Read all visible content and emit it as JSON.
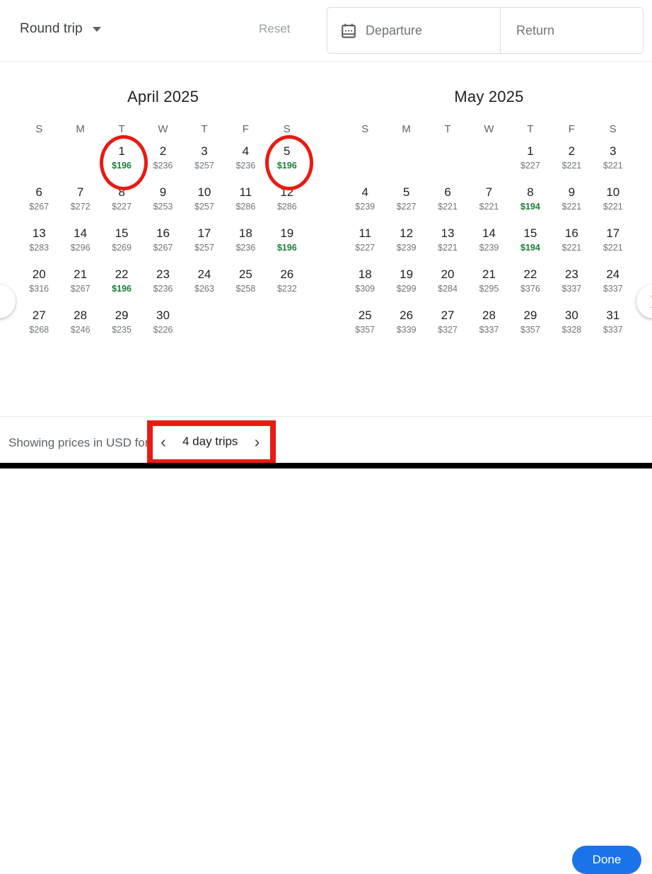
{
  "header": {
    "trip_type": "Round trip",
    "trip_type_icon": "chevron-down-icon",
    "reset_label": "Reset",
    "calendar_icon": "calendar-icon",
    "departure_placeholder": "Departure",
    "return_placeholder": "Return"
  },
  "nav": {
    "prev_icon": "chevron-left-icon",
    "next_icon": "chevron-right-icon"
  },
  "dow": [
    "S",
    "M",
    "T",
    "W",
    "T",
    "F",
    "S"
  ],
  "months": [
    {
      "title": "April 2025",
      "weeks": [
        [
          {
            "day": "",
            "price": ""
          },
          {
            "day": "",
            "price": ""
          },
          {
            "day": "1",
            "price": "$196",
            "cheap": true,
            "circled": true
          },
          {
            "day": "2",
            "price": "$236"
          },
          {
            "day": "3",
            "price": "$257"
          },
          {
            "day": "4",
            "price": "$236"
          },
          {
            "day": "5",
            "price": "$196",
            "cheap": true,
            "circled": true
          }
        ],
        [
          {
            "day": "6",
            "price": "$267"
          },
          {
            "day": "7",
            "price": "$272"
          },
          {
            "day": "8",
            "price": "$227"
          },
          {
            "day": "9",
            "price": "$253"
          },
          {
            "day": "10",
            "price": "$257"
          },
          {
            "day": "11",
            "price": "$286"
          },
          {
            "day": "12",
            "price": "$286"
          }
        ],
        [
          {
            "day": "13",
            "price": "$283"
          },
          {
            "day": "14",
            "price": "$296"
          },
          {
            "day": "15",
            "price": "$269"
          },
          {
            "day": "16",
            "price": "$267"
          },
          {
            "day": "17",
            "price": "$257"
          },
          {
            "day": "18",
            "price": "$236"
          },
          {
            "day": "19",
            "price": "$196",
            "cheap": true
          }
        ],
        [
          {
            "day": "20",
            "price": "$316"
          },
          {
            "day": "21",
            "price": "$267"
          },
          {
            "day": "22",
            "price": "$196",
            "cheap": true
          },
          {
            "day": "23",
            "price": "$236"
          },
          {
            "day": "24",
            "price": "$263"
          },
          {
            "day": "25",
            "price": "$258"
          },
          {
            "day": "26",
            "price": "$232"
          }
        ],
        [
          {
            "day": "27",
            "price": "$268"
          },
          {
            "day": "28",
            "price": "$246"
          },
          {
            "day": "29",
            "price": "$235"
          },
          {
            "day": "30",
            "price": "$226"
          },
          {
            "day": "",
            "price": ""
          },
          {
            "day": "",
            "price": ""
          },
          {
            "day": "",
            "price": ""
          }
        ]
      ]
    },
    {
      "title": "May 2025",
      "weeks": [
        [
          {
            "day": "",
            "price": ""
          },
          {
            "day": "",
            "price": ""
          },
          {
            "day": "",
            "price": ""
          },
          {
            "day": "",
            "price": ""
          },
          {
            "day": "1",
            "price": "$227"
          },
          {
            "day": "2",
            "price": "$221"
          },
          {
            "day": "3",
            "price": "$221"
          }
        ],
        [
          {
            "day": "4",
            "price": "$239"
          },
          {
            "day": "5",
            "price": "$227"
          },
          {
            "day": "6",
            "price": "$221"
          },
          {
            "day": "7",
            "price": "$221"
          },
          {
            "day": "8",
            "price": "$194",
            "cheap": true
          },
          {
            "day": "9",
            "price": "$221"
          },
          {
            "day": "10",
            "price": "$221"
          }
        ],
        [
          {
            "day": "11",
            "price": "$227"
          },
          {
            "day": "12",
            "price": "$239"
          },
          {
            "day": "13",
            "price": "$221"
          },
          {
            "day": "14",
            "price": "$239"
          },
          {
            "day": "15",
            "price": "$194",
            "cheap": true
          },
          {
            "day": "16",
            "price": "$221"
          },
          {
            "day": "17",
            "price": "$221"
          }
        ],
        [
          {
            "day": "18",
            "price": "$309"
          },
          {
            "day": "19",
            "price": "$299"
          },
          {
            "day": "20",
            "price": "$284"
          },
          {
            "day": "21",
            "price": "$295"
          },
          {
            "day": "22",
            "price": "$376"
          },
          {
            "day": "23",
            "price": "$337"
          },
          {
            "day": "24",
            "price": "$337"
          }
        ],
        [
          {
            "day": "25",
            "price": "$357"
          },
          {
            "day": "26",
            "price": "$339"
          },
          {
            "day": "27",
            "price": "$327"
          },
          {
            "day": "28",
            "price": "$337"
          },
          {
            "day": "29",
            "price": "$357"
          },
          {
            "day": "30",
            "price": "$328"
          },
          {
            "day": "31",
            "price": "$337"
          }
        ]
      ]
    }
  ],
  "footer": {
    "note": "Showing prices in USD for",
    "stepper_prev_icon": "chevron-left-icon",
    "stepper_label": "4 day trips",
    "stepper_next_icon": "chevron-right-icon",
    "done_label": "Done"
  },
  "colors": {
    "accent": "#1a73e8",
    "cheap_price": "#188038",
    "annotation": "#e81b12",
    "text_primary": "#202124",
    "text_secondary": "#5f6368"
  }
}
